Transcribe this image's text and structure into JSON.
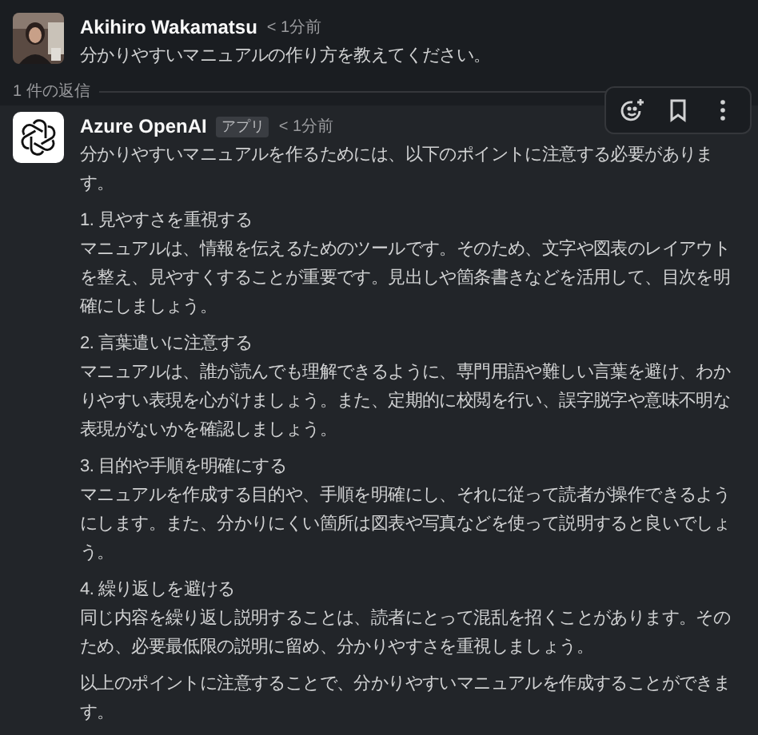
{
  "messages": [
    {
      "kind": "user",
      "author": "Akihiro Wakamatsu",
      "time": "< 1分前",
      "text": "分かりやすいマニュアルの作り方を教えてください。"
    }
  ],
  "thread": {
    "replies": "1 件の返信"
  },
  "toolbar": {
    "kind": "hover"
  },
  "reply": {
    "author": "Azure OpenAI",
    "badge": "アプリ",
    "time": "< 1分前",
    "intro": "分かりやすいマニュアルを作るためには、以下のポイントに注意する必要があります。",
    "sections": [
      {
        "heading": "1. 見やすさを重視する",
        "body": "マニュアルは、情報を伝えるためのツールです。そのため、文字や図表のレイアウトを整え、見やすくすることが重要です。見出しや箇条書きなどを活用して、目次を明確にしましょう。"
      },
      {
        "heading": "2. 言葉遣いに注意する",
        "body": "マニュアルは、誰が読んでも理解できるように、専門用語や難しい言葉を避け、わかりやすい表現を心がけましょう。また、定期的に校閲を行い、誤字脱字や意味不明な表現がないかを確認しましょう。"
      },
      {
        "heading": "3. 目的や手順を明確にする",
        "body": "マニュアルを作成する目的や、手順を明確にし、それに従って読者が操作できるようにします。また、分かりにくい箇所は図表や写真などを使って説明すると良いでしょう。"
      },
      {
        "heading": "4. 繰り返しを避ける",
        "body": "同じ内容を繰り返し説明することは、読者にとって混乱を招くことがあります。そのため、必要最低限の説明に留め、分かりやすさを重視しましょう。"
      }
    ],
    "closing": "以上のポイントに注意することで、分かりやすいマニュアルを作成することができます。"
  }
}
